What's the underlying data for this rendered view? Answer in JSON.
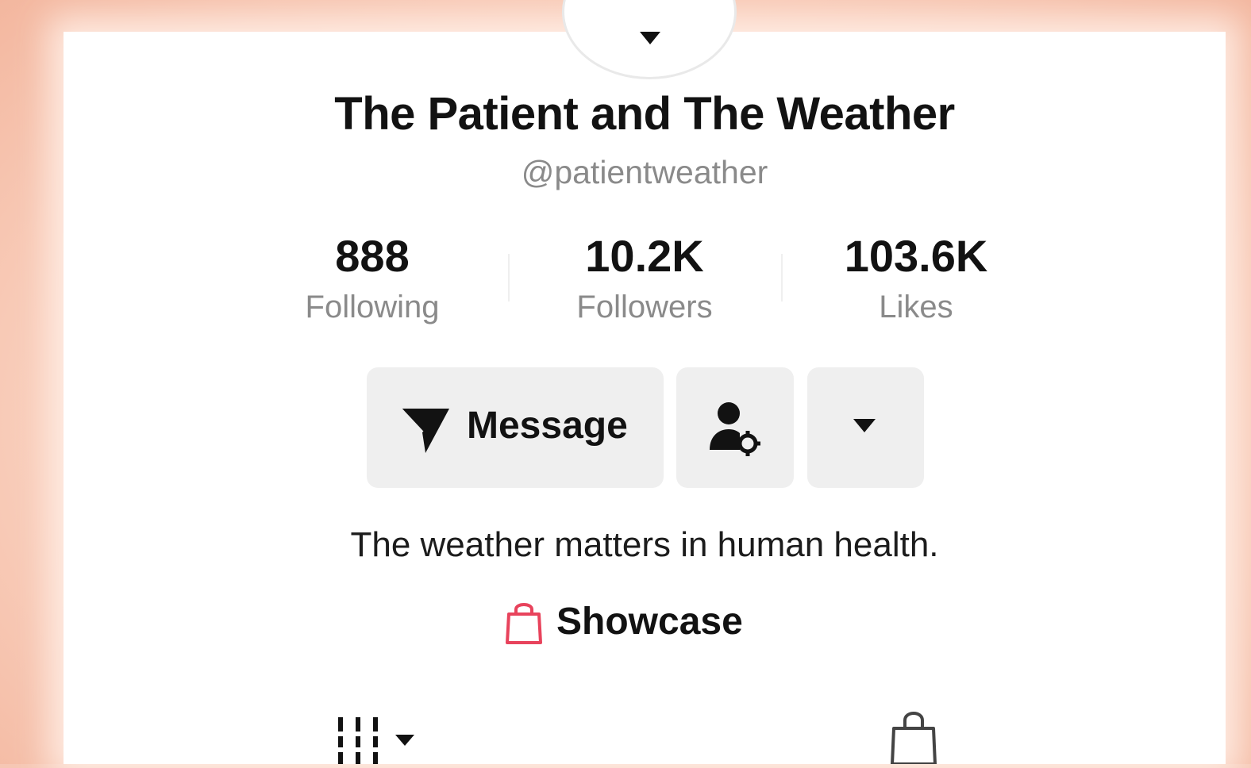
{
  "profile": {
    "display_name": "The Patient and The Weather",
    "handle": "@patientweather",
    "bio": "The weather matters in human health."
  },
  "stats": [
    {
      "value": "888",
      "label": "Following"
    },
    {
      "value": "10.2K",
      "label": "Followers"
    },
    {
      "value": "103.6K",
      "label": "Likes"
    }
  ],
  "actions": {
    "message_label": "Message"
  },
  "showcase": {
    "label": "Showcase"
  },
  "colors": {
    "accent": "#e8435c",
    "frame": "#f6c7b4",
    "button_bg": "#efefef",
    "text_primary": "#121212",
    "text_secondary": "#8a8a8a"
  },
  "icons": {
    "message": "send-icon",
    "user_settings": "user-settings-icon",
    "more": "caret-down-icon",
    "showcase": "shopping-bag-icon",
    "videos_tab": "grid-icon",
    "shop_tab": "shopping-bag-icon"
  }
}
